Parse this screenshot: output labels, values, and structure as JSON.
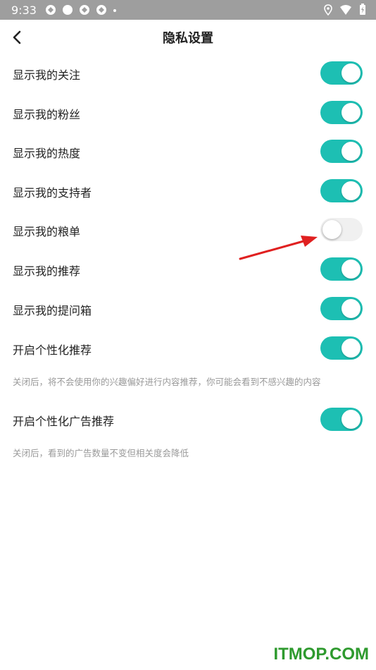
{
  "status_bar": {
    "time": "9:33",
    "icons_left": [
      "sync-icon",
      "circle-icon",
      "sync-icon",
      "sync-icon",
      "dot-icon"
    ],
    "icons_right": [
      "location-icon",
      "wifi-icon",
      "battery-icon"
    ]
  },
  "header": {
    "title": "隐私设置",
    "back_icon": "back-chevron-icon"
  },
  "settings": [
    {
      "label": "显示我的关注",
      "enabled": true
    },
    {
      "label": "显示我的粉丝",
      "enabled": true
    },
    {
      "label": "显示我的热度",
      "enabled": true
    },
    {
      "label": "显示我的支持者",
      "enabled": true
    },
    {
      "label": "显示我的粮单",
      "enabled": false
    },
    {
      "label": "显示我的推荐",
      "enabled": true
    },
    {
      "label": "显示我的提问箱",
      "enabled": true
    },
    {
      "label": "开启个性化推荐",
      "enabled": true,
      "hint": "关闭后，将不会使用你的兴趣偏好进行内容推荐，你可能会看到不感兴趣的内容"
    },
    {
      "label": "开启个性化广告推荐",
      "enabled": true,
      "hint": "关闭后，看到的广告数量不变但相关度会降低"
    }
  ],
  "colors": {
    "toggle_on": "#1dbfb3",
    "toggle_off": "#f0f0f0",
    "arrow": "#e02020",
    "status_bar": "#9e9e9e"
  },
  "watermark": "ITMOP.COM"
}
